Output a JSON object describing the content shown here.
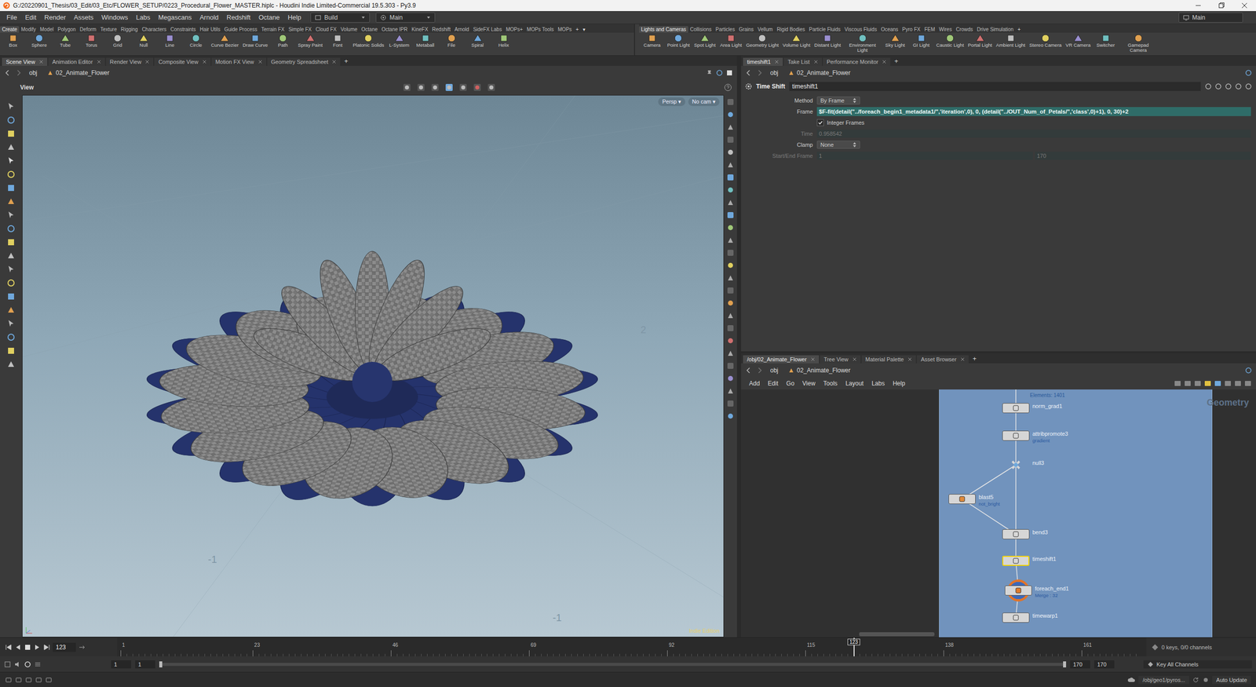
{
  "window": {
    "title": "G:/20220901_Thesis/03_Edit/03_Etc/FLOWER_SETUP/0223_Procedural_Flower_MASTER.hiplc - Houdini Indie Limited-Commercial 19.5.303 - Py3.9"
  },
  "menu": [
    "File",
    "Edit",
    "Render",
    "Assets",
    "Windows",
    "Labs",
    "Megascans",
    "Arnold",
    "Redshift",
    "Octane",
    "Help"
  ],
  "desktop": {
    "label": "Build",
    "tab": "Main"
  },
  "right_desktop": "Main",
  "shelf_left": {
    "tabs": [
      {
        "label": "Create",
        "selected": true
      },
      {
        "label": "Modify",
        "selected": false
      },
      {
        "label": "Model",
        "selected": false
      },
      {
        "label": "Polygon",
        "selected": false
      },
      {
        "label": "Deform",
        "selected": false
      },
      {
        "label": "Texture",
        "selected": false
      },
      {
        "label": "Rigging",
        "selected": false
      },
      {
        "label": "Characters",
        "selected": false
      },
      {
        "label": "Constraints",
        "selected": false
      },
      {
        "label": "Hair Utils",
        "selected": false
      },
      {
        "label": "Guide Process",
        "selected": false
      },
      {
        "label": "Terrain FX",
        "selected": false
      },
      {
        "label": "Simple FX",
        "selected": false
      },
      {
        "label": "Cloud FX",
        "selected": false
      },
      {
        "label": "Volume",
        "selected": false
      },
      {
        "label": "Octane",
        "selected": false
      },
      {
        "label": "Octane IPR",
        "selected": false
      },
      {
        "label": "KineFX",
        "selected": false
      },
      {
        "label": "Redshift",
        "selected": false
      },
      {
        "label": "Arnold",
        "selected": false
      },
      {
        "label": "SideFX Labs",
        "selected": false
      },
      {
        "label": "MOPs+",
        "selected": false
      },
      {
        "label": "MOPs Tools",
        "selected": false
      },
      {
        "label": "MOPs",
        "selected": false
      }
    ],
    "extras": [
      "+",
      "▾"
    ],
    "tools": [
      "Box",
      "Sphere",
      "Tube",
      "Torus",
      "Grid",
      "Null",
      "Line",
      "Circle",
      "Curve Bezier",
      "Draw Curve",
      "Path",
      "Spray Paint",
      "Font",
      "Platonic Solids",
      "L-System",
      "Metaball",
      "File",
      "Spiral",
      "Helix"
    ]
  },
  "shelf_right": {
    "tabs": [
      {
        "label": "Lights and Cameras",
        "selected": true
      },
      {
        "label": "Collisions",
        "selected": false
      },
      {
        "label": "Particles",
        "selected": false
      },
      {
        "label": "Grains",
        "selected": false
      },
      {
        "label": "Vellum",
        "selected": false
      },
      {
        "label": "Rigid Bodies",
        "selected": false
      },
      {
        "label": "Particle Fluids",
        "selected": false
      },
      {
        "label": "Viscous Fluids",
        "selected": false
      },
      {
        "label": "Oceans",
        "selected": false
      },
      {
        "label": "Pyro FX",
        "selected": false
      },
      {
        "label": "FEM",
        "selected": false
      },
      {
        "label": "Wires",
        "selected": false
      },
      {
        "label": "Crowds",
        "selected": false
      },
      {
        "label": "Drive Simulation",
        "selected": false
      }
    ],
    "extras": [
      "+"
    ],
    "tools": [
      "Camera",
      "Point Light",
      "Spot Light",
      "Area Light",
      "Geometry Light",
      "Volume Light",
      "Distant Light",
      "Environment Light",
      "Sky Light",
      "GI Light",
      "Caustic Light",
      "Portal Light",
      "Ambient Light",
      "Stereo Camera",
      "VR Camera",
      "Switcher",
      "Gamepad Camera"
    ]
  },
  "scene_pane": {
    "tabs": [
      {
        "label": "Scene View",
        "selected": true
      },
      {
        "label": "Animation Editor",
        "selected": false
      },
      {
        "label": "Render View",
        "selected": false
      },
      {
        "label": "Composite View",
        "selected": false
      },
      {
        "label": "Motion FX View",
        "selected": false
      },
      {
        "label": "Geometry Spreadsheet",
        "selected": false
      }
    ],
    "add_tab": "+",
    "path": [
      "obj",
      "02_Animate_Flower"
    ],
    "view_label": "View",
    "camera_menus": [
      "Persp ▾",
      "No cam ▾"
    ],
    "grid_labels": [
      "2",
      "-1",
      "-1"
    ],
    "watermark": "Indie Edition"
  },
  "param_pane": {
    "tabs": [
      {
        "label": "timeshift1",
        "selected": true
      },
      {
        "label": "Take List",
        "selected": false
      },
      {
        "label": "Performance Monitor",
        "selected": false
      }
    ],
    "add_tab": "+",
    "path": [
      "obj",
      "02_Animate_Flower"
    ],
    "node_type": "Time Shift",
    "node_name": "timeshift1",
    "params": [
      {
        "kind": "menu",
        "label": "Method",
        "value": "By Frame",
        "disabled": false
      },
      {
        "kind": "expr",
        "label": "Frame",
        "value": "$F-fit(detail(\"../foreach_begin1_metadata1/\",'iteration',0), 0, (detail(\"../OUT_Num_of_Petals/\",'class',0)+1), 0, 30)+2",
        "disabled": false
      },
      {
        "kind": "toggle",
        "label": "Integer Frames",
        "checked": true,
        "disabled": false
      },
      {
        "kind": "field",
        "label": "Time",
        "value": "0.958542",
        "disabled": true
      },
      {
        "kind": "menu",
        "label": "Clamp",
        "value": "None",
        "disabled": false
      },
      {
        "kind": "range",
        "label": "Start/End Frame",
        "values": [
          "1",
          "170"
        ],
        "disabled": true
      }
    ]
  },
  "network_pane": {
    "tabs": [
      {
        "label": "/obj/02_Animate_Flower",
        "selected": true
      },
      {
        "label": "Tree View",
        "selected": false
      },
      {
        "label": "Material Palette",
        "selected": false
      },
      {
        "label": "Asset Browser",
        "selected": false
      }
    ],
    "add_tab": "+",
    "path": [
      "obj",
      "02_Animate_Flower"
    ],
    "menu": [
      "Add",
      "Edit",
      "Go",
      "View",
      "Tools",
      "Layout",
      "Labs",
      "Help"
    ],
    "context": "Geometry",
    "box_note": "Elements: 1401",
    "nodes": [
      {
        "name": "norm_grad1",
        "sub": "",
        "kind": "sop",
        "color": "#d8d8d8",
        "selected": false
      },
      {
        "name": "attribpromote3",
        "sub": "gradient",
        "kind": "sop",
        "color": "#d8d8d8",
        "selected": false
      },
      {
        "name": "null3",
        "sub": "",
        "kind": "null",
        "color": "#d8d8d8",
        "selected": false
      },
      {
        "name": "blast5",
        "sub": "not_bright",
        "kind": "sop",
        "color": "#e08a3a",
        "selected": false
      },
      {
        "name": "bend3",
        "sub": "",
        "kind": "sop",
        "color": "#d8d8d8",
        "selected": false
      },
      {
        "name": "timeshift1",
        "sub": "",
        "kind": "sop",
        "color": "#d8d8d8",
        "selected": true
      },
      {
        "name": "foreach_end1",
        "sub": "Merge : 32",
        "kind": "block_end",
        "color": "#e07a2a",
        "selected": false
      },
      {
        "name": "timewarp1",
        "sub": "",
        "kind": "sop",
        "color": "#d8d8d8",
        "selected": false
      }
    ]
  },
  "timeline": {
    "frame": "123",
    "start": "1",
    "end": "170",
    "ticks": [
      "1",
      "23",
      "46",
      "69",
      "92",
      "115",
      "138",
      "161"
    ],
    "playhead": "123",
    "keys": "0 keys, 0/0 channels"
  },
  "range": {
    "start": [
      "1",
      "1"
    ],
    "end": [
      "170",
      "170"
    ],
    "key_mode": "Key All Channels"
  },
  "status": {
    "path": "/obj/geo1/pyros...",
    "update": "Auto Update"
  }
}
